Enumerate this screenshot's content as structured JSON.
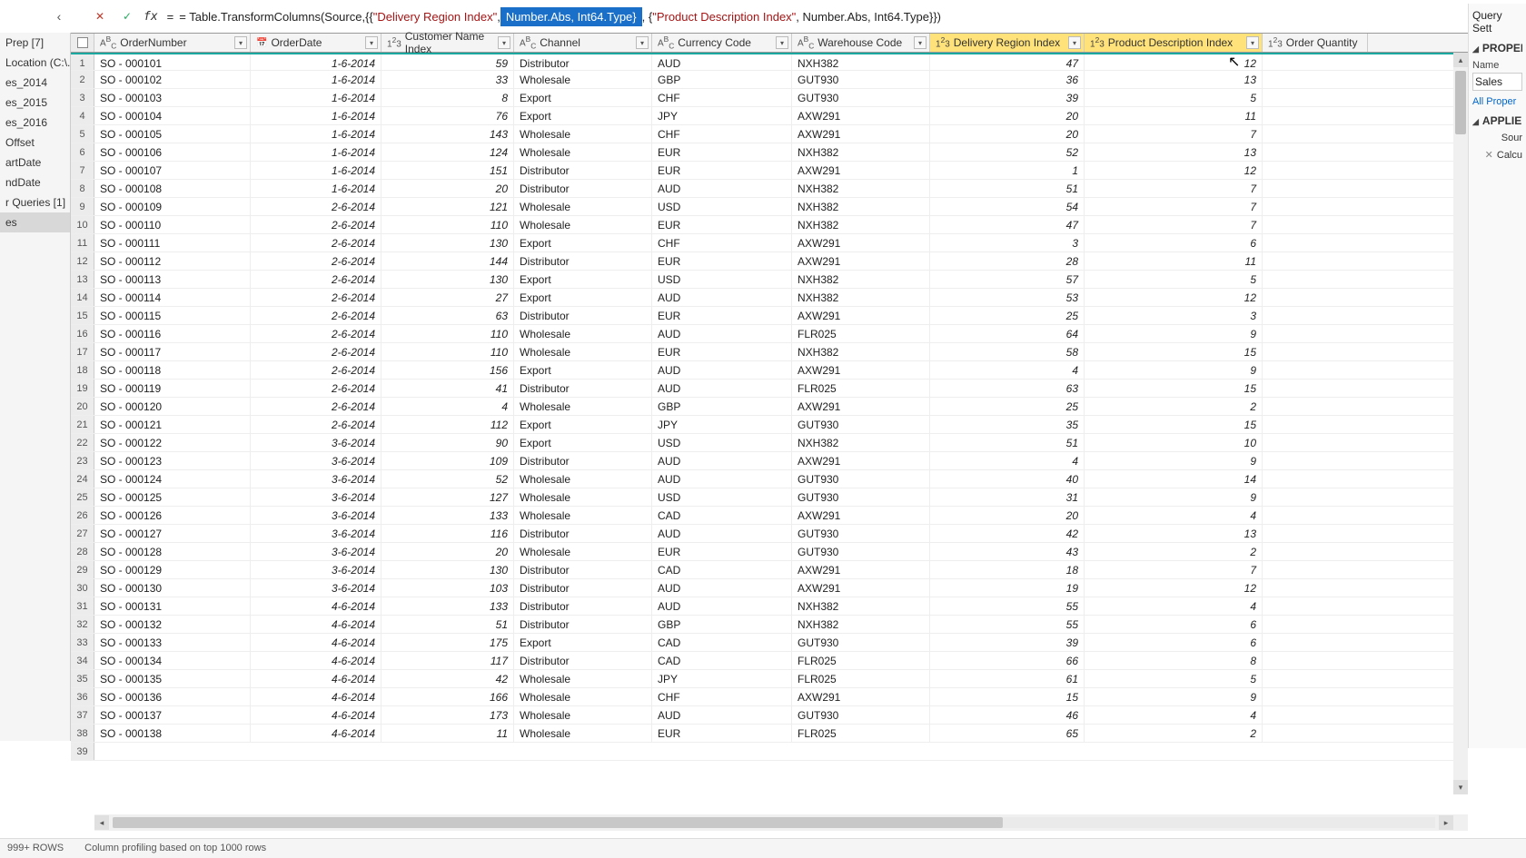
{
  "formula": {
    "prefix": "= Table.TransformColumns(Source,{{",
    "str1": "\"Delivery Region Index\"",
    "sep1": ", ",
    "selected": "Number.Abs, Int64.Type}",
    "sep2": ", {",
    "str2": "\"Product Description Index\"",
    "suffix": ", Number.Abs, Int64.Type}})"
  },
  "queries": {
    "items": [
      "Prep [7]",
      "Location (C:\\...",
      "es_2014",
      "es_2015",
      "es_2016",
      "Offset",
      "artDate",
      "ndDate",
      "r Queries [1]",
      "es"
    ]
  },
  "settings": {
    "title": "Query Sett",
    "prop": "PROPERTI",
    "nameLabel": "Name",
    "nameValue": "Sales",
    "allProps": "All Proper",
    "applied": "APPLIED",
    "steps": [
      "Sour",
      "Calcu"
    ]
  },
  "columns": [
    {
      "label": "OrderNumber",
      "type": "ABC"
    },
    {
      "label": "OrderDate",
      "type": "cal"
    },
    {
      "label": "Customer Name Index",
      "type": "123"
    },
    {
      "label": "Channel",
      "type": "ABC"
    },
    {
      "label": "Currency Code",
      "type": "ABC"
    },
    {
      "label": "Warehouse Code",
      "type": "ABC"
    },
    {
      "label": "Delivery Region Index",
      "type": "123",
      "hl": true
    },
    {
      "label": "Product Description Index",
      "type": "123",
      "hl": true
    },
    {
      "label": "Order Quantity",
      "type": "123"
    }
  ],
  "rows": [
    [
      "SO - 000101",
      "1-6-2014",
      "59",
      "Distributor",
      "AUD",
      "NXH382",
      "47",
      "12"
    ],
    [
      "SO - 000102",
      "1-6-2014",
      "33",
      "Wholesale",
      "GBP",
      "GUT930",
      "36",
      "13"
    ],
    [
      "SO - 000103",
      "1-6-2014",
      "8",
      "Export",
      "CHF",
      "GUT930",
      "39",
      "5"
    ],
    [
      "SO - 000104",
      "1-6-2014",
      "76",
      "Export",
      "JPY",
      "AXW291",
      "20",
      "11"
    ],
    [
      "SO - 000105",
      "1-6-2014",
      "143",
      "Wholesale",
      "CHF",
      "AXW291",
      "20",
      "7"
    ],
    [
      "SO - 000106",
      "1-6-2014",
      "124",
      "Wholesale",
      "EUR",
      "NXH382",
      "52",
      "13"
    ],
    [
      "SO - 000107",
      "1-6-2014",
      "151",
      "Distributor",
      "EUR",
      "AXW291",
      "1",
      "12"
    ],
    [
      "SO - 000108",
      "1-6-2014",
      "20",
      "Distributor",
      "AUD",
      "NXH382",
      "51",
      "7"
    ],
    [
      "SO - 000109",
      "2-6-2014",
      "121",
      "Wholesale",
      "USD",
      "NXH382",
      "54",
      "7"
    ],
    [
      "SO - 000110",
      "2-6-2014",
      "110",
      "Wholesale",
      "EUR",
      "NXH382",
      "47",
      "7"
    ],
    [
      "SO - 000111",
      "2-6-2014",
      "130",
      "Export",
      "CHF",
      "AXW291",
      "3",
      "6"
    ],
    [
      "SO - 000112",
      "2-6-2014",
      "144",
      "Distributor",
      "EUR",
      "AXW291",
      "28",
      "11"
    ],
    [
      "SO - 000113",
      "2-6-2014",
      "130",
      "Export",
      "USD",
      "NXH382",
      "57",
      "5"
    ],
    [
      "SO - 000114",
      "2-6-2014",
      "27",
      "Export",
      "AUD",
      "NXH382",
      "53",
      "12"
    ],
    [
      "SO - 000115",
      "2-6-2014",
      "63",
      "Distributor",
      "EUR",
      "AXW291",
      "25",
      "3"
    ],
    [
      "SO - 000116",
      "2-6-2014",
      "110",
      "Wholesale",
      "AUD",
      "FLR025",
      "64",
      "9"
    ],
    [
      "SO - 000117",
      "2-6-2014",
      "110",
      "Wholesale",
      "EUR",
      "NXH382",
      "58",
      "15"
    ],
    [
      "SO - 000118",
      "2-6-2014",
      "156",
      "Export",
      "AUD",
      "AXW291",
      "4",
      "9"
    ],
    [
      "SO - 000119",
      "2-6-2014",
      "41",
      "Distributor",
      "AUD",
      "FLR025",
      "63",
      "15"
    ],
    [
      "SO - 000120",
      "2-6-2014",
      "4",
      "Wholesale",
      "GBP",
      "AXW291",
      "25",
      "2"
    ],
    [
      "SO - 000121",
      "2-6-2014",
      "112",
      "Export",
      "JPY",
      "GUT930",
      "35",
      "15"
    ],
    [
      "SO - 000122",
      "3-6-2014",
      "90",
      "Export",
      "USD",
      "NXH382",
      "51",
      "10"
    ],
    [
      "SO - 000123",
      "3-6-2014",
      "109",
      "Distributor",
      "AUD",
      "AXW291",
      "4",
      "9"
    ],
    [
      "SO - 000124",
      "3-6-2014",
      "52",
      "Wholesale",
      "AUD",
      "GUT930",
      "40",
      "14"
    ],
    [
      "SO - 000125",
      "3-6-2014",
      "127",
      "Wholesale",
      "USD",
      "GUT930",
      "31",
      "9"
    ],
    [
      "SO - 000126",
      "3-6-2014",
      "133",
      "Wholesale",
      "CAD",
      "AXW291",
      "20",
      "4"
    ],
    [
      "SO - 000127",
      "3-6-2014",
      "116",
      "Distributor",
      "AUD",
      "GUT930",
      "42",
      "13"
    ],
    [
      "SO - 000128",
      "3-6-2014",
      "20",
      "Wholesale",
      "EUR",
      "GUT930",
      "43",
      "2"
    ],
    [
      "SO - 000129",
      "3-6-2014",
      "130",
      "Distributor",
      "CAD",
      "AXW291",
      "18",
      "7"
    ],
    [
      "SO - 000130",
      "3-6-2014",
      "103",
      "Distributor",
      "AUD",
      "AXW291",
      "19",
      "12"
    ],
    [
      "SO - 000131",
      "4-6-2014",
      "133",
      "Distributor",
      "AUD",
      "NXH382",
      "55",
      "4"
    ],
    [
      "SO - 000132",
      "4-6-2014",
      "51",
      "Distributor",
      "GBP",
      "NXH382",
      "55",
      "6"
    ],
    [
      "SO - 000133",
      "4-6-2014",
      "175",
      "Export",
      "CAD",
      "GUT930",
      "39",
      "6"
    ],
    [
      "SO - 000134",
      "4-6-2014",
      "117",
      "Distributor",
      "CAD",
      "FLR025",
      "66",
      "8"
    ],
    [
      "SO - 000135",
      "4-6-2014",
      "42",
      "Wholesale",
      "JPY",
      "FLR025",
      "61",
      "5"
    ],
    [
      "SO - 000136",
      "4-6-2014",
      "166",
      "Wholesale",
      "CHF",
      "AXW291",
      "15",
      "9"
    ],
    [
      "SO - 000137",
      "4-6-2014",
      "173",
      "Wholesale",
      "AUD",
      "GUT930",
      "46",
      "4"
    ],
    [
      "SO - 000138",
      "4-6-2014",
      "11",
      "Wholesale",
      "EUR",
      "FLR025",
      "65",
      "2"
    ]
  ],
  "extraRowNum": "39",
  "status": {
    "rows": "999+ ROWS",
    "profiling": "Column profiling based on top 1000 rows"
  }
}
